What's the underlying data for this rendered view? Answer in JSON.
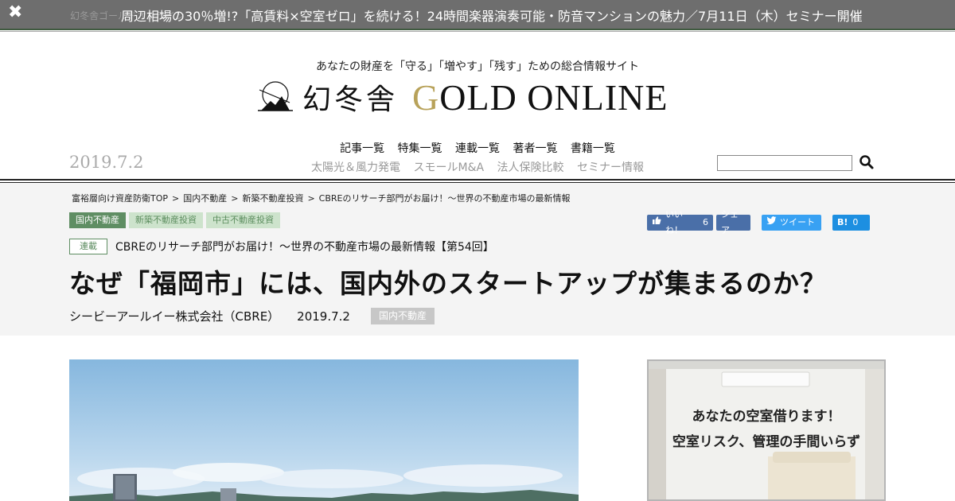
{
  "banner": {
    "underlying_text": "幻冬舎ゴールドオンライン",
    "message": "周辺相場の30％増!?「高賃料×空室ゼロ」を続ける！24時間楽器演奏可能・防音マンションの魅力／7月11日（木）セミナー開催",
    "close_icon": "close-icon"
  },
  "header": {
    "tagline": "あなたの財産を「守る」「増やす」「残す」ための総合情報サイト",
    "logo_kanji": "幻冬舎",
    "logo_word_g": "G",
    "logo_word_rest": "OLD ONLINE",
    "date": "2019.7.2",
    "nav_main": [
      "記事一覧",
      "特集一覧",
      "連載一覧",
      "著者一覧",
      "書籍一覧"
    ],
    "nav_sub": [
      "太陽光＆風力発電",
      "スモールM&A",
      "法人保険比較",
      "セミナー情報"
    ],
    "search_placeholder": "",
    "search_icon": "search-icon"
  },
  "breadcrumb": [
    "富裕層向け資産防衛TOP",
    "国内不動産",
    "新築不動産投資",
    "CBREのリサーチ部門がお届け！～世界の不動産市場の最新情報"
  ],
  "breadcrumb_separator": ">",
  "tags": [
    "国内不動産",
    "新築不動産投資",
    "中古不動産投資"
  ],
  "social": {
    "fb_like": "いいね！",
    "fb_like_count": "6",
    "fb_share": "シェア",
    "tweet": "ツイート",
    "hatena": "B!",
    "hatena_count": "0"
  },
  "article": {
    "series_label": "連載",
    "series_title": "CBREのリサーチ部門がお届け！～世界の不動産市場の最新情報【第54回】",
    "headline": "なぜ「福岡市」には、国内外のスタートアップが集まるのか？",
    "author": "シービーアールイー株式会社（CBRE）",
    "date": "2019.7.2",
    "category_badge": "国内不動産"
  },
  "ad": {
    "line1": "あなたの空室借ります！",
    "line2": "空室リスク、管理の手間いらず"
  },
  "colors": {
    "banner_bg": "#6e6e6e",
    "brand_green": "#5f8e63",
    "logo_gold": "#b8a25a",
    "facebook": "#4a6fa8",
    "twitter": "#38a1f3",
    "hatena": "#1d8fe1"
  }
}
